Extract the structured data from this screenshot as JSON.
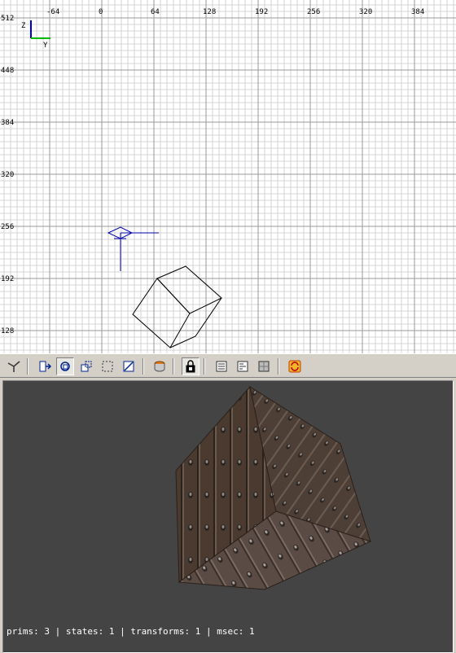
{
  "ortho_view": {
    "x_tick_labels": [
      "-64",
      "0",
      "64",
      "128",
      "192",
      "256",
      "320",
      "384"
    ],
    "y_tick_labels": [
      "512",
      "448",
      "384",
      "320",
      "256",
      "192",
      "128"
    ],
    "axis_z_label": "Z",
    "axis_y_label": "Y",
    "axis_colors": {
      "vertical": "#0000cc",
      "horizontal": "#00bb00"
    },
    "grid_colors": {
      "minor": "#d4d4d4",
      "major": "#9a9a9a"
    }
  },
  "toolbar": {
    "buttons": [
      {
        "name": "camera-tool-icon",
        "active": false
      },
      {
        "name": "select-icon",
        "active": false
      },
      {
        "name": "rotate-icon",
        "active": true
      },
      {
        "name": "scale-icon",
        "active": false
      },
      {
        "name": "select-box-icon",
        "active": false
      },
      {
        "name": "resize-icon",
        "active": false
      },
      {
        "name": "cylinder-icon",
        "active": false
      },
      {
        "name": "lock-icon",
        "active": true
      },
      {
        "name": "entity-list-icon",
        "active": false
      },
      {
        "name": "inspector-icon",
        "active": false
      },
      {
        "name": "texture-icon",
        "active": false
      },
      {
        "name": "refresh-icon",
        "active": false
      }
    ]
  },
  "perspective_view": {
    "stats_text": "prims: 3 | states: 1 | transforms: 1 | msec: 1",
    "background": "#444444"
  }
}
